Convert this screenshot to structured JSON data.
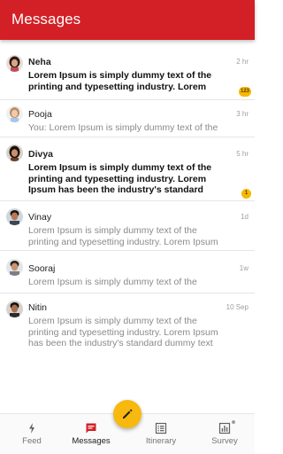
{
  "appbar": {
    "title": "Messages"
  },
  "messages": [
    {
      "name": "Neha",
      "time": "2 hr",
      "preview": "Lorem Ipsum is simply dummy text of the printing and typesetting industry. Lorem Ipsum",
      "unread": true,
      "badge": "123"
    },
    {
      "name": "Pooja",
      "time": "3 hr",
      "preview": "You: Lorem Ipsum is simply dummy text of the",
      "unread": false,
      "badge": ""
    },
    {
      "name": "Divya",
      "time": "5 hr",
      "preview": "Lorem Ipsum is simply dummy text of the printing and typesetting industry. Lorem Ipsum has been the industry's standard dummy text",
      "unread": true,
      "badge": "1"
    },
    {
      "name": "Vinay",
      "time": "1d",
      "preview": "Lorem Ipsum is simply dummy text of the printing and typesetting industry. Lorem Ipsum",
      "unread": false,
      "badge": ""
    },
    {
      "name": "Sooraj",
      "time": "1w",
      "preview": "Lorem Ipsum is simply dummy text of the",
      "unread": false,
      "badge": ""
    },
    {
      "name": "Nitin",
      "time": "10 Sep",
      "preview": "Lorem Ipsum is simply dummy text of the printing and typesetting industry. Lorem Ipsum has been the industry's standard dummy text",
      "unread": false,
      "badge": ""
    }
  ],
  "bottom_nav": {
    "feed": "Feed",
    "messages": "Messages",
    "itinerary": "Itinerary",
    "survey": "Survey"
  },
  "fab": {
    "icon": "pencil-icon"
  },
  "colors": {
    "appbar": "#d32026",
    "accent": "#f7b90f",
    "badge": "#f6b800"
  }
}
